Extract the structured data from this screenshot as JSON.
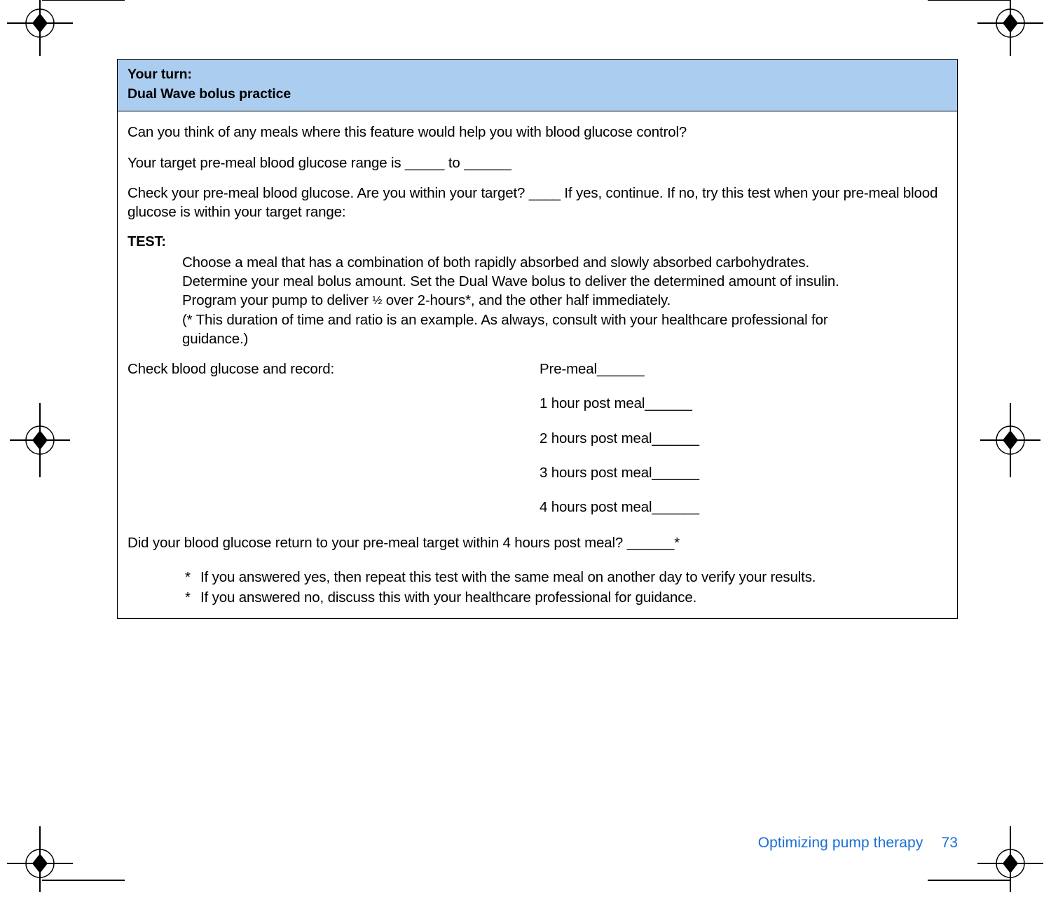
{
  "page": {
    "header_band_color": "#abcdf0",
    "footer_color": "#1a6fd4"
  },
  "worksheet": {
    "header": {
      "line1": "Your turn:",
      "line2": "Dual Wave bolus practice"
    },
    "paragraphs": {
      "q1": "Can you think of any meals where this feature would help you with blood glucose control?",
      "q2": "Your target pre-meal blood glucose range is _____ to ______",
      "q3_line1": "Check your pre-meal blood glucose. Are you within your target? ____ If yes, continue. If no, try this test when",
      "q3_line2": "your pre-meal blood glucose is within your target range:"
    },
    "test": {
      "label": "TEST:",
      "line1": "Choose a meal that has a combination of both rapidly absorbed and slowly absorbed carbohydrates.",
      "line2": "Determine your meal bolus amount. Set the Dual Wave bolus to deliver the determined amount of insulin.",
      "line3_a": "Program your pump to deliver ",
      "line3_frac": "½",
      "line3_b": " over 2-hours*, and the other half immediately.",
      "note_line1": "(* This duration of time and ratio is an example. As always, consult with your healthcare professional for",
      "note_line2": "guidance.)"
    },
    "record": {
      "prompt": "Check blood glucose and record:",
      "entries": [
        "Pre-meal______",
        "1 hour post meal______",
        "2 hours post meal______",
        "3 hours post meal______",
        "4 hours post meal______"
      ]
    },
    "final_question": "Did your blood glucose return to your pre-meal target within 4 hours post meal? ______*",
    "notes": [
      {
        "star": "*",
        "text": "If you answered yes, then repeat this test with the same meal on another day to verify your results."
      },
      {
        "star": "*",
        "text": "If you answered no, discuss this with your healthcare professional for guidance."
      }
    ]
  },
  "footer": {
    "section_title": "Optimizing pump therapy",
    "page_number": "73"
  }
}
